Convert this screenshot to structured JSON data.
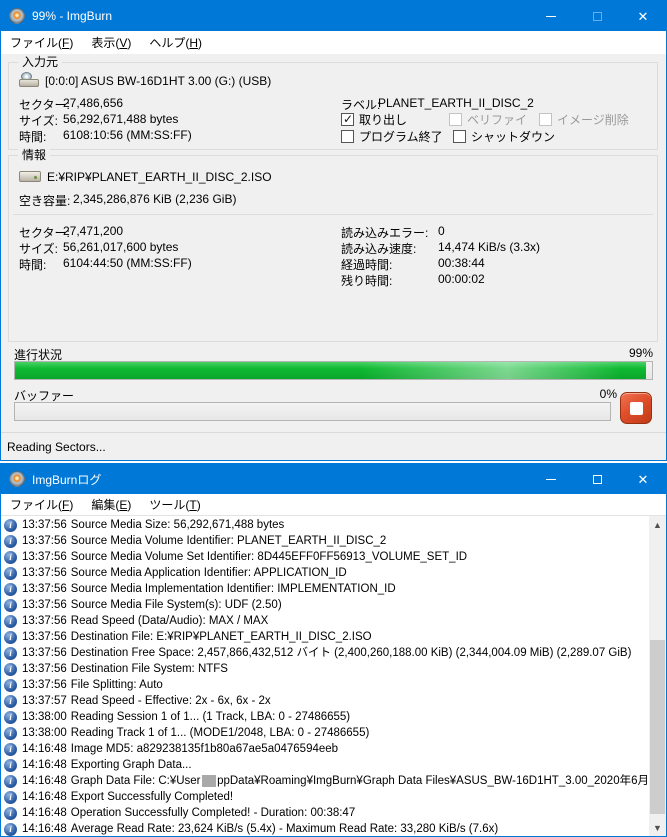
{
  "main_window": {
    "title": "99% - ImgBurn",
    "menu": [
      {
        "pre": "ファイル(",
        "key": "F",
        "post": ")"
      },
      {
        "pre": "表示(",
        "key": "V",
        "post": ")"
      },
      {
        "pre": "ヘルプ(",
        "key": "H",
        "post": ")"
      }
    ],
    "source": {
      "group_label": "入力元",
      "device": "[0:0:0] ASUS BW-16D1HT 3.00 (G:) (USB)",
      "stats": [
        {
          "label": "セクター:",
          "value": "27,486,656"
        },
        {
          "label": "サイズ:",
          "value": "56,292,671,488 bytes"
        },
        {
          "label": "時間:",
          "value": "6108:10:56 (MM:SS:FF)"
        }
      ],
      "disc_label": {
        "label": "ラベル:",
        "value": "PLANET_EARTH_II_DISC_2"
      },
      "checkboxes": [
        {
          "label": "取り出し",
          "checked": true,
          "disabled": false
        },
        {
          "label": "ベリファイ",
          "checked": false,
          "disabled": true
        },
        {
          "label": "イメージ削除",
          "checked": false,
          "disabled": true
        },
        {
          "label": "プログラム終了",
          "checked": false,
          "disabled": false
        },
        {
          "label": "シャットダウン",
          "checked": false,
          "disabled": false
        }
      ]
    },
    "info": {
      "group_label": "情報",
      "file_path": "E:¥RIP¥PLANET_EARTH_II_DISC_2.ISO",
      "free_space": {
        "label": "空き容量:",
        "value": "2,345,286,876 KiB  (2,236 GiB)"
      },
      "stats_left": [
        {
          "label": "セクター:",
          "value": "27,471,200"
        },
        {
          "label": "サイズ:",
          "value": "56,261,017,600 bytes"
        },
        {
          "label": "時間:",
          "value": "6104:44:50 (MM:SS:FF)"
        }
      ],
      "stats_right": [
        {
          "label": "読み込みエラー:",
          "value": "0"
        },
        {
          "label": "読み込み速度:",
          "value": "14,474 KiB/s (3.3x)"
        },
        {
          "label": "経過時間:",
          "value": "00:38:44"
        },
        {
          "label": "残り時間:",
          "value": "00:00:02"
        }
      ]
    },
    "progress": {
      "label": "進行状況",
      "percent_text": "99%",
      "percent": 99
    },
    "buffer": {
      "label": "バッファー",
      "percent_text": "0%",
      "percent": 0
    },
    "status_text": "Reading Sectors..."
  },
  "log_window": {
    "title": "ImgBurnログ",
    "menu": [
      {
        "pre": "ファイル(",
        "key": "F",
        "post": ")"
      },
      {
        "pre": "編集(",
        "key": "E",
        "post": ")"
      },
      {
        "pre": "ツール(",
        "key": "T",
        "post": ")"
      }
    ],
    "entries": [
      {
        "time": "13:37:56",
        "text": "Source Media Size: 56,292,671,488 bytes"
      },
      {
        "time": "13:37:56",
        "text": "Source Media Volume Identifier: PLANET_EARTH_II_DISC_2"
      },
      {
        "time": "13:37:56",
        "text": "Source Media Volume Set Identifier: 8D445EFF0FF56913_VOLUME_SET_ID"
      },
      {
        "time": "13:37:56",
        "text": "Source Media Application Identifier: APPLICATION_ID"
      },
      {
        "time": "13:37:56",
        "text": "Source Media Implementation Identifier: IMPLEMENTATION_ID"
      },
      {
        "time": "13:37:56",
        "text": "Source Media File System(s): UDF (2.50)"
      },
      {
        "time": "13:37:56",
        "text": "Read Speed (Data/Audio): MAX / MAX"
      },
      {
        "time": "13:37:56",
        "text": "Destination File: E:¥RIP¥PLANET_EARTH_II_DISC_2.ISO"
      },
      {
        "time": "13:37:56",
        "text": "Destination Free Space: 2,457,866,432,512 バイト (2,400,260,188.00 KiB) (2,344,004.09 MiB) (2,289.07 GiB)"
      },
      {
        "time": "13:37:56",
        "text": "Destination File System: NTFS"
      },
      {
        "time": "13:37:56",
        "text": "File Splitting: Auto"
      },
      {
        "time": "13:37:57",
        "text": "Read Speed - Effective: 2x - 6x, 6x - 2x"
      },
      {
        "time": "13:38:00",
        "text": "Reading Session 1 of 1... (1 Track, LBA: 0 - 27486655)"
      },
      {
        "time": "13:38:00",
        "text": "Reading Track 1 of 1... (MODE1/2048, LBA: 0 - 27486655)"
      },
      {
        "time": "14:16:48",
        "text": "Image MD5: a829238135f1b80a67ae5a0476594eeb"
      },
      {
        "time": "14:16:48",
        "text": "Exporting Graph Data..."
      },
      {
        "time": "14:16:48",
        "text": "Graph Data File: C:¥User",
        "redacted": true,
        "text_after": "ppData¥Roaming¥ImgBurn¥Graph Data Files¥ASUS_BW-16D1HT_3.00_2020年6月"
      },
      {
        "time": "14:16:48",
        "text": "Export Successfully Completed!"
      },
      {
        "time": "14:16:48",
        "text": "Operation Successfully Completed! - Duration: 00:38:47"
      },
      {
        "time": "14:16:48",
        "text": "Average Read Rate: 23,624 KiB/s (5.4x) - Maximum Read Rate: 33,280 KiB/s (7.6x)"
      }
    ]
  },
  "colors": {
    "titlebar_blue": "#0078d7",
    "client_bg": "#f0f0f0",
    "progress_green": "#0db32e",
    "stop_button_red": "#dd4426",
    "redaction_gray": "#a9a9a9"
  }
}
